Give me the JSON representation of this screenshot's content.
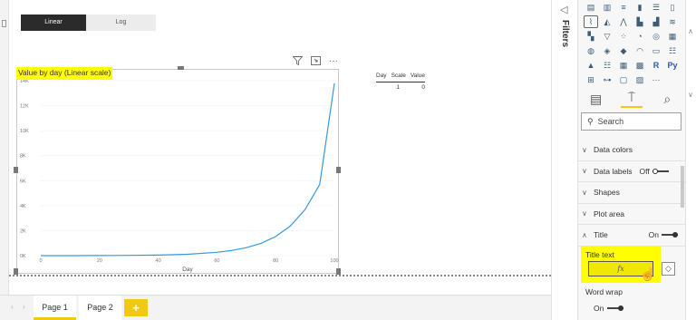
{
  "toggle": {
    "linear_label": "Linear",
    "log_label": "Log"
  },
  "visual": {
    "title": "Value by day (Linear scale)",
    "filter_icon": "funnel-icon",
    "focus_icon": "focus-mode-icon",
    "more_label": "···"
  },
  "chart_data": {
    "type": "line",
    "title": "Value by day (Linear scale)",
    "xlabel": "Day",
    "ylabel": "",
    "x_ticks": [
      "0",
      "20",
      "40",
      "60",
      "80",
      "100"
    ],
    "y_ticks": [
      "0K",
      "2K",
      "4K",
      "6K",
      "8K",
      "10K",
      "12K",
      "14K"
    ],
    "xlim": [
      0,
      100
    ],
    "ylim": [
      0,
      14000
    ],
    "series": [
      {
        "x": [
          0,
          10,
          20,
          30,
          40,
          50,
          60,
          65,
          70,
          75,
          80,
          85,
          90,
          95,
          100
        ],
        "y": [
          1,
          3,
          8,
          19,
          45,
          110,
          265,
          410,
          640,
          990,
          1530,
          2370,
          3680,
          5700,
          13800
        ],
        "color": "#3599d8"
      }
    ],
    "grid": true,
    "legend": "none"
  },
  "table": {
    "headers": [
      "Day",
      "Scale",
      "Value"
    ],
    "rows": [
      [
        "1",
        "0"
      ]
    ]
  },
  "filters": {
    "label": "Filters",
    "collapse_icon": "chevron-left-icon"
  },
  "viz_icons": [
    "stacked-bar-icon",
    "stacked-column-icon",
    "clustered-bar-icon",
    "clustered-column-icon",
    "100-bar-icon",
    "100-column-icon",
    "line-chart-icon",
    "area-chart-icon",
    "stacked-area-icon",
    "line-column-icon",
    "line-stacked-column-icon",
    "ribbon-chart-icon",
    "waterfall-icon",
    "funnel-chart-icon",
    "scatter-icon",
    "pie-chart-icon",
    "donut-chart-icon",
    "treemap-icon",
    "map-icon",
    "filled-map-icon",
    "shape-map-icon",
    "gauge-icon",
    "card-icon",
    "multi-row-card-icon",
    "kpi-icon",
    "slicer-icon",
    "table-icon",
    "matrix-icon",
    "r-visual-icon",
    "python-visual-icon",
    "key-influencers-icon",
    "decomposition-tree-icon",
    "qa-icon",
    "paginated-icon",
    "more-visuals-icon"
  ],
  "pane_tabs": [
    "fields-icon",
    "format-paint-roller-icon",
    "analytics-magnifier-icon"
  ],
  "search": {
    "placeholder": "Search"
  },
  "format_sections": [
    {
      "label": "Data colors",
      "state": ""
    },
    {
      "label": "Data labels",
      "state": "Off"
    },
    {
      "label": "Shapes",
      "state": ""
    },
    {
      "label": "Plot area",
      "state": ""
    },
    {
      "label": "Title",
      "state": "On"
    }
  ],
  "title_text": {
    "label": "Title text",
    "fx_label": "fx"
  },
  "word_wrap": {
    "label": "Word wrap",
    "state": "On"
  },
  "pages": {
    "tab1": "Page 1",
    "tab2": "Page 2",
    "add": "+"
  }
}
